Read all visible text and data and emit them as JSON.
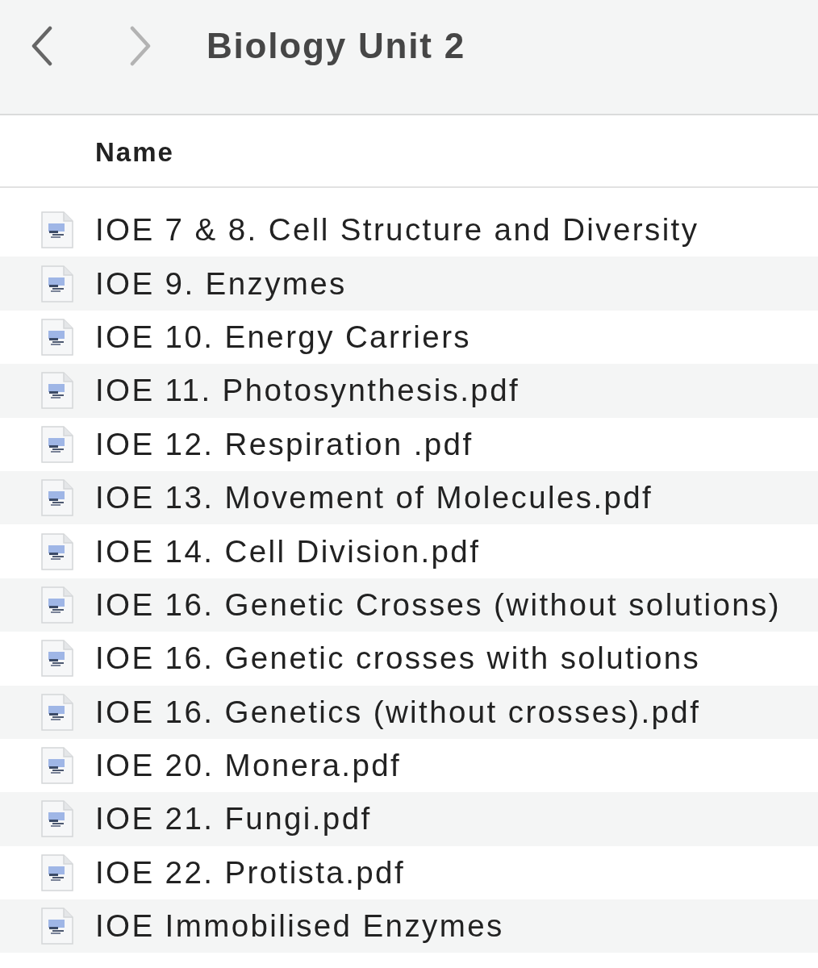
{
  "toolbar": {
    "nav_buttons": [
      {
        "kind": "back",
        "disabled": false
      },
      {
        "kind": "forward",
        "disabled": true
      }
    ],
    "title": "Biology Unit 2"
  },
  "table": {
    "columns": [
      "Name"
    ],
    "rows": [
      {
        "name": "IOE 7 & 8. Cell Structure and Diversity"
      },
      {
        "name": "IOE 9. Enzymes"
      },
      {
        "name": "IOE 10. Energy Carriers"
      },
      {
        "name": "IOE 11. Photosynthesis.pdf"
      },
      {
        "name": "IOE 12. Respiration .pdf"
      },
      {
        "name": "IOE 13. Movement of Molecules.pdf"
      },
      {
        "name": "IOE 14. Cell Division.pdf"
      },
      {
        "name": "IOE 16. Genetic Crosses (without solutions)"
      },
      {
        "name": "IOE 16. Genetic crosses with solutions"
      },
      {
        "name": "IOE 16. Genetics (without crosses).pdf"
      },
      {
        "name": "IOE 20. Monera.pdf"
      },
      {
        "name": "IOE 21. Fungi.pdf"
      },
      {
        "name": "IOE 22. Protista.pdf"
      },
      {
        "name": "IOE Immobilised Enzymes"
      }
    ]
  }
}
